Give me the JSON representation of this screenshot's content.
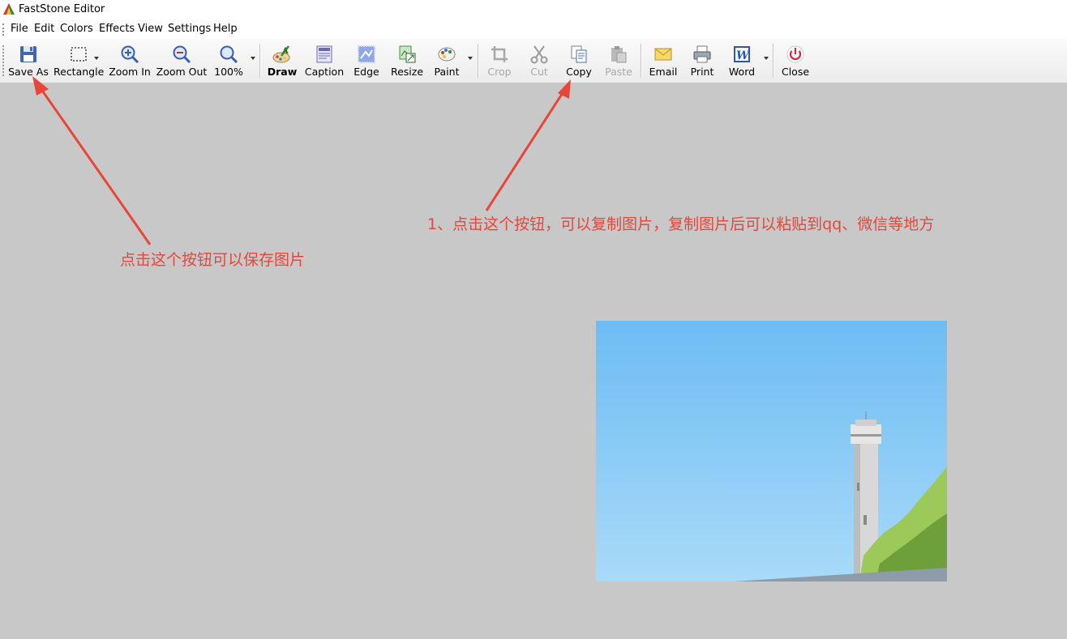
{
  "window": {
    "title": "FastStone Editor"
  },
  "menu": [
    "File",
    "Edit",
    "Colors",
    "Effects",
    "View",
    "Settings",
    "Help"
  ],
  "toolbar": {
    "save_as": "Save As",
    "rectangle": "Rectangle",
    "zoom_in": "Zoom In",
    "zoom_out": "Zoom Out",
    "zoom_level": "100%",
    "draw": "Draw",
    "caption": "Caption",
    "edge": "Edge",
    "resize": "Resize",
    "paint": "Paint",
    "crop": "Crop",
    "cut": "Cut",
    "copy": "Copy",
    "paste": "Paste",
    "email": "Email",
    "print": "Print",
    "word": "Word",
    "close": "Close"
  },
  "annotations": {
    "save_note": "点击这个按钮可以保存图片",
    "copy_note": "1、点击这个按钮，可以复制图片，复制图片后可以粘贴到qq、微信等地方"
  },
  "colors": {
    "annotation": "#e8463a",
    "canvas": "#c8c8c8",
    "sky": "#7cc3f3"
  },
  "icons": [
    "floppy-disk-icon",
    "rectangle-select-icon",
    "zoom-in-icon",
    "zoom-out-icon",
    "zoom-icon",
    "draw-icon",
    "caption-icon",
    "edge-icon",
    "resize-icon",
    "paint-icon",
    "crop-icon",
    "scissors-icon",
    "copy-icon",
    "paste-icon",
    "envelope-icon",
    "printer-icon",
    "word-icon",
    "power-icon"
  ]
}
